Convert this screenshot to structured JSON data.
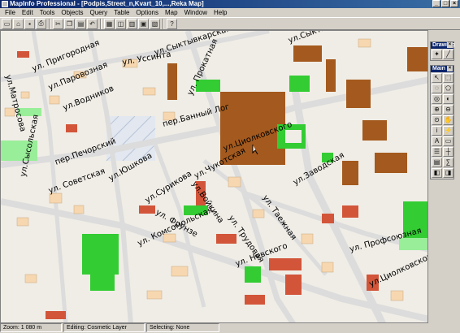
{
  "window": {
    "title": "MapInfo Professional - [Podpis,Street_n,Kvart_10,...,Reka Map]",
    "controls": [
      "_",
      "□",
      "×"
    ]
  },
  "menu": [
    "File",
    "Edit",
    "Tools",
    "Objects",
    "Query",
    "Table",
    "Options",
    "Map",
    "Window",
    "Help"
  ],
  "toolbar_icons": [
    "new-icon",
    "open-icon",
    "save-icon",
    "print-icon",
    "cut-icon",
    "copy-icon",
    "paste-icon",
    "undo-icon",
    "new-browser-icon",
    "new-mapper-icon",
    "new-graph-icon",
    "new-layout-icon",
    "redistrict-icon",
    "help-icon"
  ],
  "drawing_palette": {
    "title": "Drawing",
    "icons": [
      "symbol-style-icon",
      "line-style-icon"
    ]
  },
  "main_palette": {
    "title": "Main",
    "icons": [
      "select-icon",
      "marquee-select-icon",
      "radius-select-icon",
      "polygon-select-icon",
      "boundary-select-icon",
      "invert-select-icon",
      "zoom-in-icon",
      "zoom-out-icon",
      "change-view-icon",
      "grabber-icon",
      "info-icon",
      "hot-link-icon",
      "label-icon",
      "drag-window-icon",
      "layer-control-icon",
      "ruler-icon",
      "legend-icon",
      "statistics-icon",
      "clip-region-icon",
      "set-clip-icon"
    ]
  },
  "map": {
    "colors": {
      "background": "#f0ede6",
      "street": "#dcdcdc",
      "building_brown": "#a45a1e",
      "building_red": "#d2553a",
      "building_peach": "#f6d7b0",
      "park_green": "#33cc33",
      "light_green": "#99ee99"
    },
    "labels": [
      "ул.Матросова",
      "ул. Пригородная",
      "ул.Паровозная",
      "ул.Водников",
      "ул. Уссинта",
      "ул.Сыктывкарская",
      "ул. Прокатная",
      "ул.Сыктывкарская",
      "пер.Банный Лог",
      "пер.Печорский",
      "ул. Советская",
      "ул.Сысольская",
      "ул.Сурикова",
      "ул.Чукотская",
      "ул.Циолковского",
      "ул.Заводская",
      "ул.Войкина",
      "ул. Трудовая",
      "ул. Таежная",
      "ул.Юшкова",
      "ул. Фрунзе",
      "ул. Комсомольская",
      "ул. Невского",
      "ул. Профсоюзная",
      "ул.Циолковского"
    ]
  },
  "status": {
    "zoom": "Zoom: 1 080 m",
    "editing": "Editing: Cosmetic Layer",
    "selecting": "Selecting: None"
  }
}
